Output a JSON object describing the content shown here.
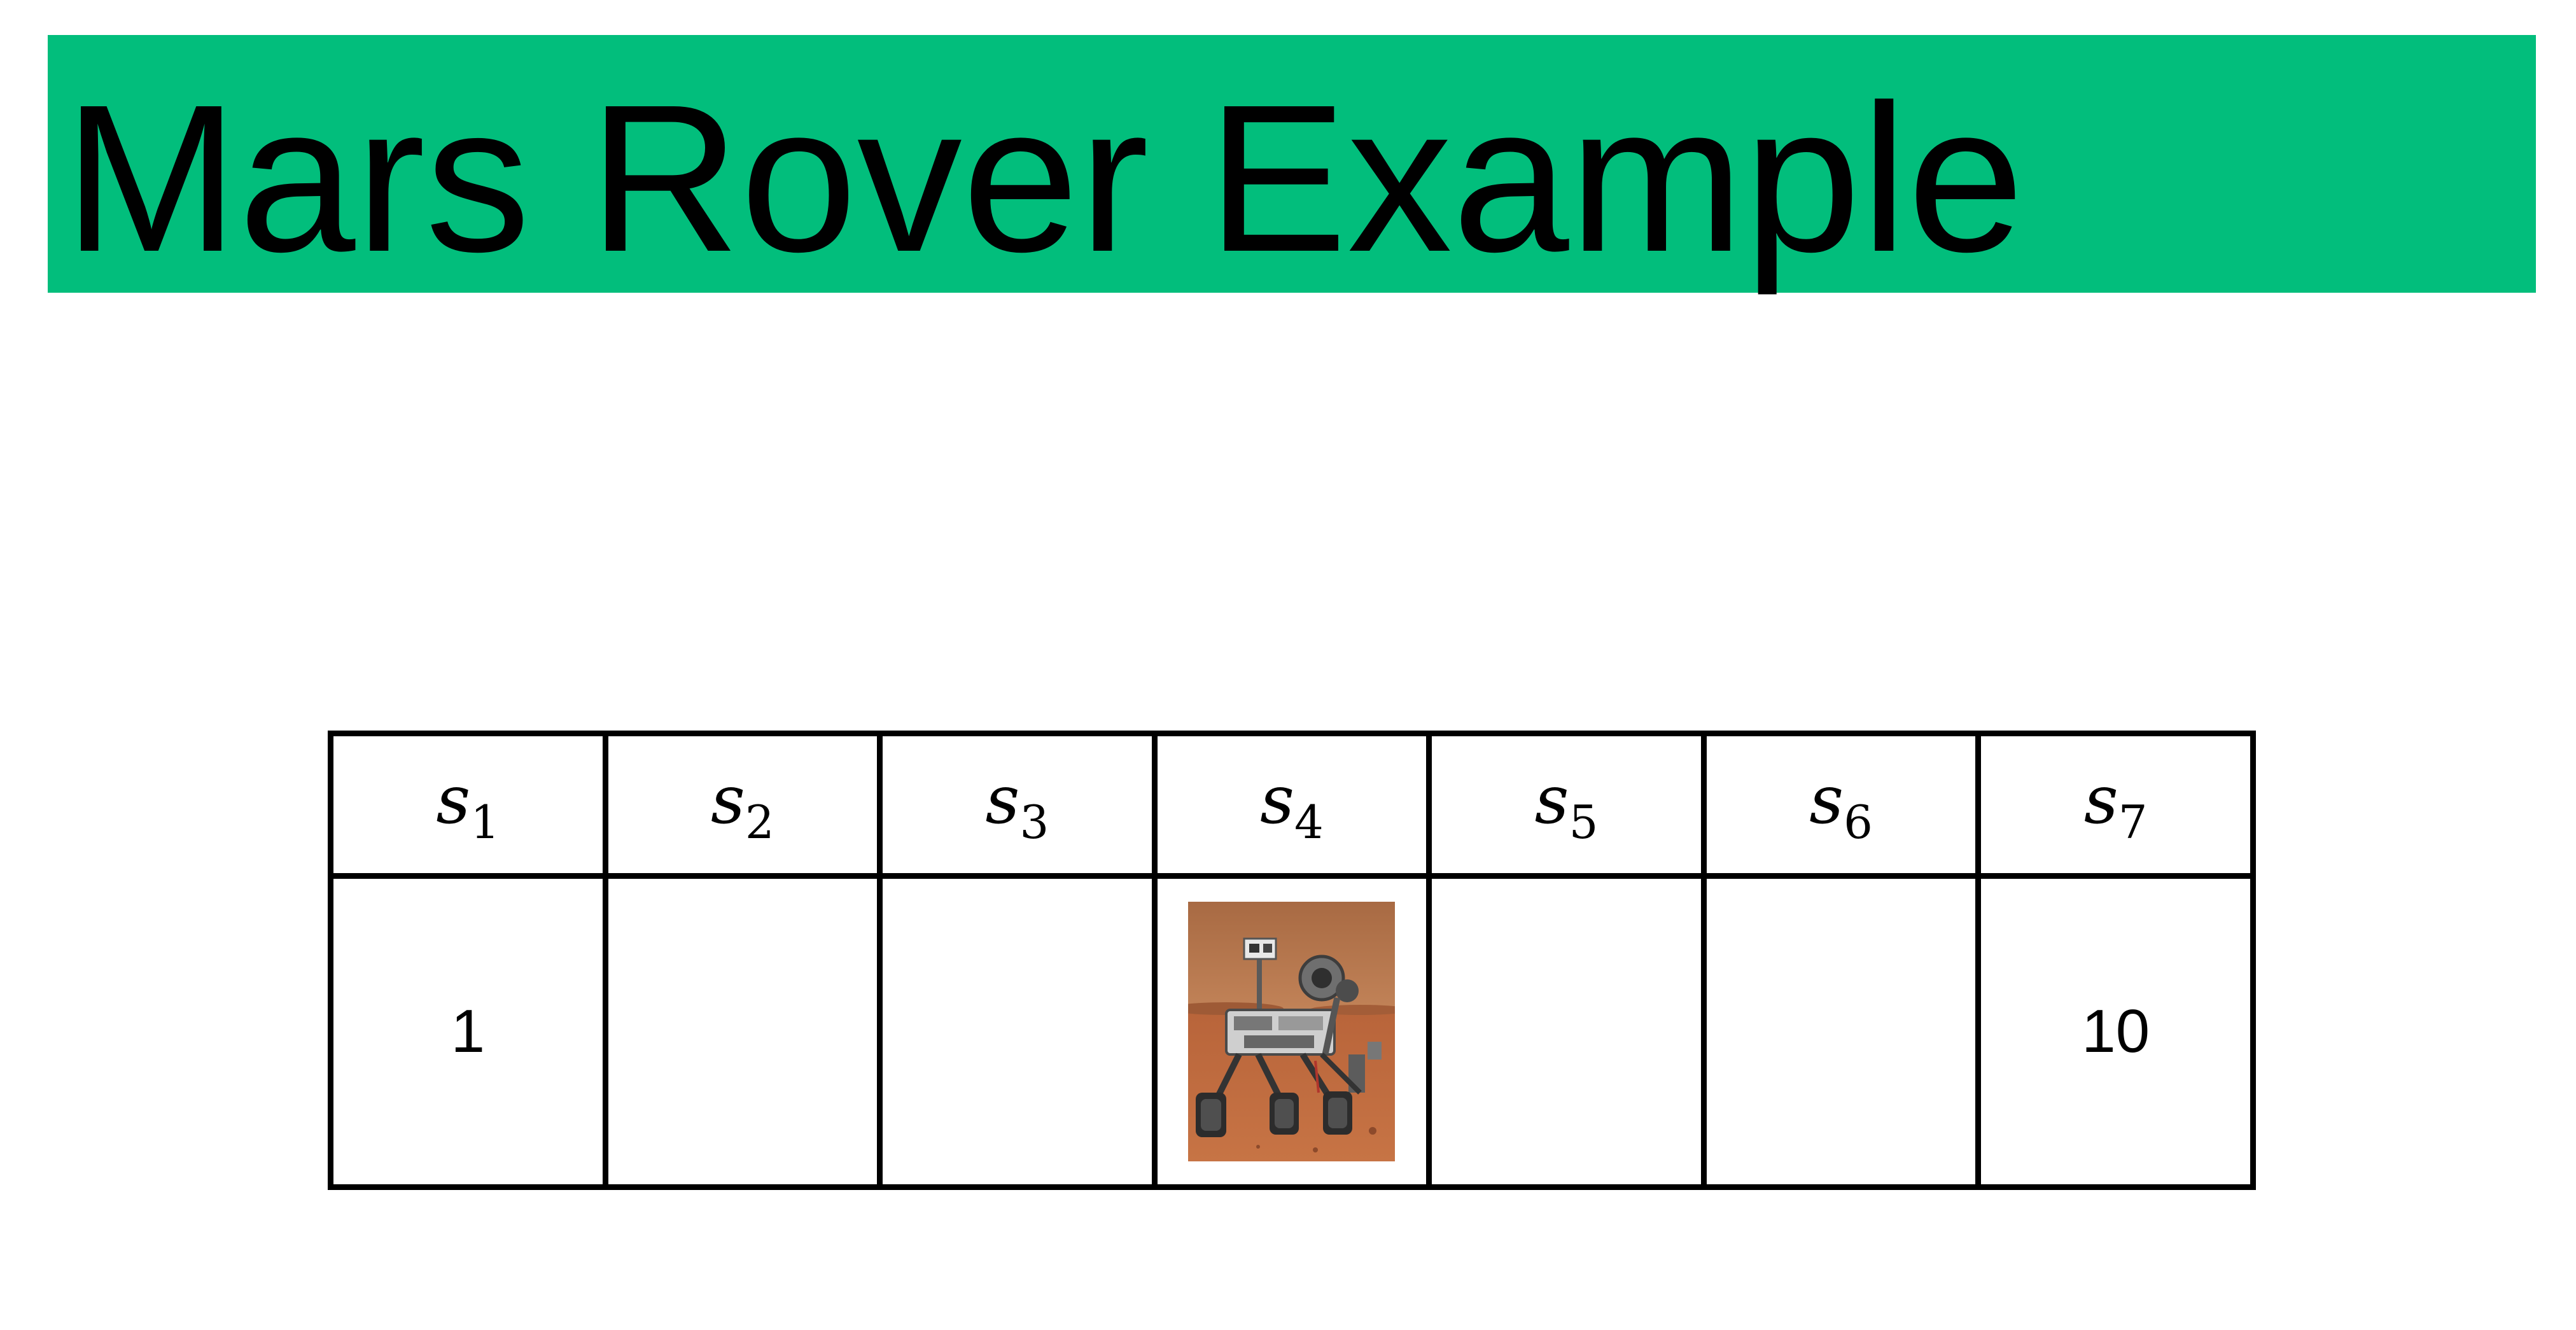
{
  "header": {
    "title": "Mars Rover Example"
  },
  "grid": {
    "states": [
      {
        "letter": "s",
        "index": "1",
        "reward": "1",
        "has_rover": false
      },
      {
        "letter": "s",
        "index": "2",
        "reward": "",
        "has_rover": false
      },
      {
        "letter": "s",
        "index": "3",
        "reward": "",
        "has_rover": false
      },
      {
        "letter": "s",
        "index": "4",
        "reward": "",
        "has_rover": true
      },
      {
        "letter": "s",
        "index": "5",
        "reward": "",
        "has_rover": false
      },
      {
        "letter": "s",
        "index": "6",
        "reward": "",
        "has_rover": false
      },
      {
        "letter": "s",
        "index": "7",
        "reward": "10",
        "has_rover": false
      }
    ]
  },
  "rover": {
    "icon": "mars-rover-icon"
  },
  "colors": {
    "title_bar": "#02be7c",
    "grid_lines": "#000000",
    "text": "#000000"
  }
}
